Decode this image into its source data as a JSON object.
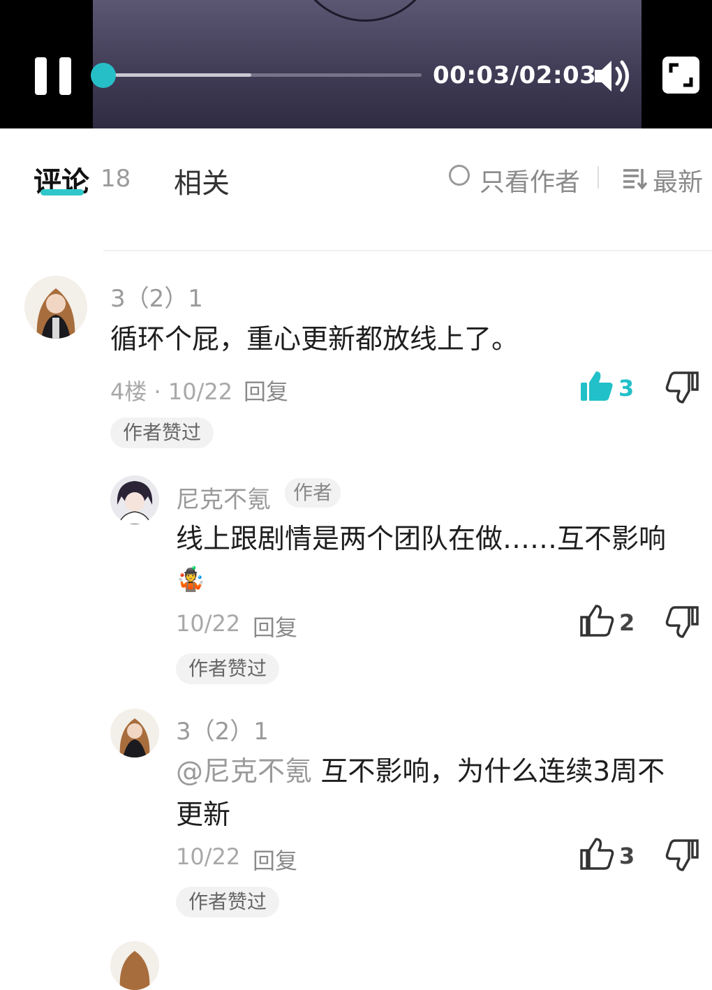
{
  "player": {
    "time": "00:03/02:03",
    "progress_fraction": 0.0,
    "buffered_fraction": 0.47
  },
  "tabs": {
    "comments_label": "评论",
    "comments_count": "18",
    "related_label": "相关",
    "only_author_label": "只看作者",
    "sort_label": "最新"
  },
  "comments": [
    {
      "username": "3（2）1",
      "content": "循环个屁，重心更新都放线上了。",
      "meta": "4楼 · 10/22",
      "reply_label": "回复",
      "likes": "3",
      "liked": true,
      "badge": "作者赞过"
    },
    {
      "username": "尼克不氪",
      "author_tag": "作者",
      "content": "线上跟剧情是两个团队在做……互不影响",
      "emoji": "🤹",
      "meta": "10/22",
      "reply_label": "回复",
      "likes": "2",
      "badge": "作者赞过"
    },
    {
      "username": "3（2）1",
      "mention": "@尼克不氪",
      "content_line1": "互不影响，为什么连续3周不",
      "content_line2": "更新",
      "meta": "10/22",
      "reply_label": "回复",
      "likes": "3",
      "badge": "作者赞过"
    }
  ],
  "colors": {
    "accent": "#22c0c8",
    "player_bg": "#000000",
    "video_bg": "#4a4662"
  },
  "icons": [
    "pause-icon",
    "volume-icon",
    "fullscreen-icon",
    "radio-icon",
    "sort-icon",
    "thumbs-up-icon",
    "thumbs-down-icon"
  ]
}
